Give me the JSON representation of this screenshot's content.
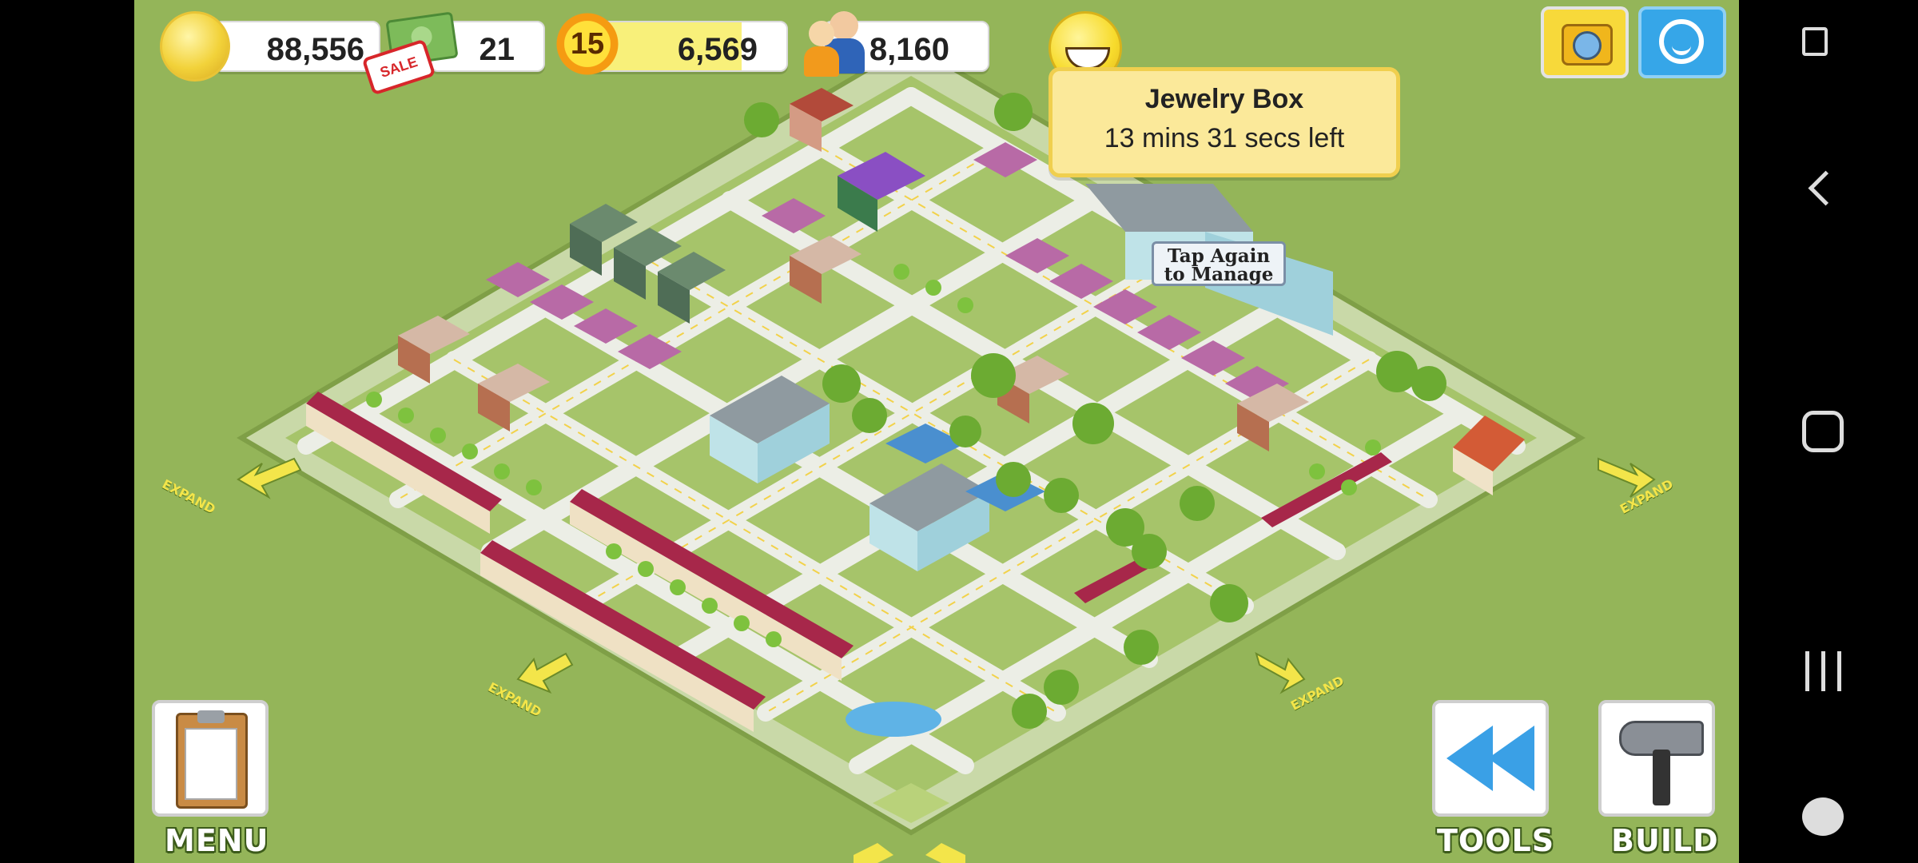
{
  "hud": {
    "coins": "88,556",
    "cash": "21",
    "sale_label": "SALE",
    "level": "15",
    "xp": "6,569",
    "population": "8,160"
  },
  "tooltip": {
    "title": "Jewelry Box",
    "time_left": "13 mins 31 secs left"
  },
  "tap_label": {
    "line1": "Tap Again",
    "line2": "to Manage"
  },
  "buttons": {
    "menu": "MENU",
    "tools": "TOOLS",
    "build": "BUILD"
  },
  "expand_label": "EXPAND",
  "icons": {
    "coin": "coin-icon",
    "cash": "cash-icon",
    "xp": "star-burst-icon",
    "population": "people-icon",
    "happiness": "smiley-icon",
    "camera": "camera-icon",
    "social": "social-icon"
  },
  "colors": {
    "grass": "#94b559",
    "road": "#e9eae4",
    "tooltip_bg": "#fbe99a",
    "expand_arrow": "#f3e54a"
  }
}
